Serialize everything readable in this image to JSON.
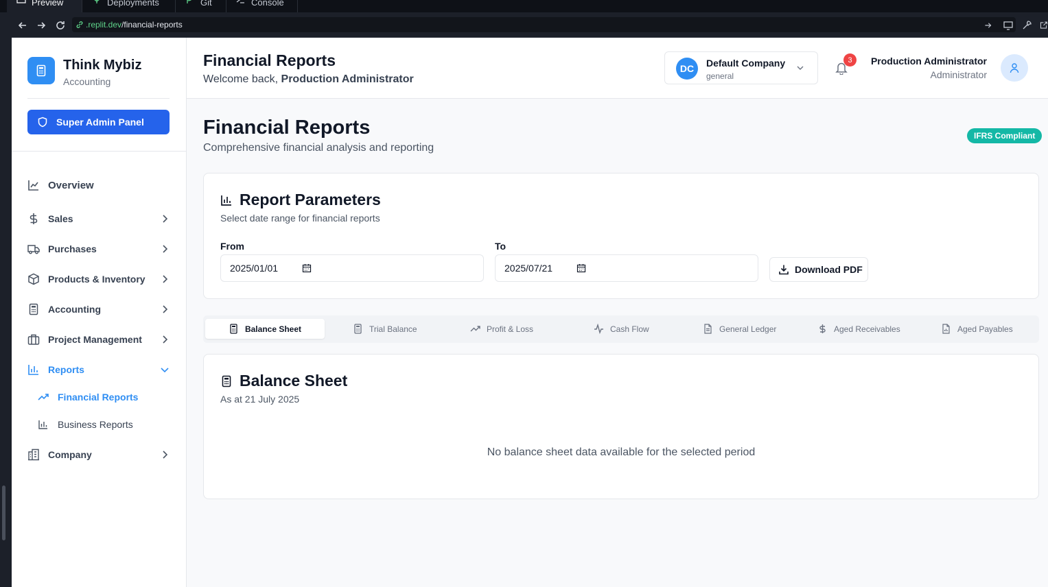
{
  "ide": {
    "tabs": [
      "Preview",
      "Deployments",
      "Git",
      "Console"
    ],
    "url_host": ".replit.dev",
    "url_path": "/financial-reports"
  },
  "sidebar": {
    "brand_title": "Think Mybiz",
    "brand_sub": "Accounting",
    "admin_button": "Super Admin Panel",
    "items": [
      {
        "label": "Overview",
        "icon": "line-chart-icon"
      },
      {
        "label": "Sales",
        "icon": "dollar-icon"
      },
      {
        "label": "Purchases",
        "icon": "truck-icon"
      },
      {
        "label": "Products & Inventory",
        "icon": "box-icon"
      },
      {
        "label": "Accounting",
        "icon": "calculator-icon"
      },
      {
        "label": "Project Management",
        "icon": "briefcase-icon"
      },
      {
        "label": "Reports",
        "icon": "bar-chart-icon"
      },
      {
        "label": "Company",
        "icon": "building-icon"
      }
    ],
    "sub_items": [
      {
        "label": "Financial Reports",
        "icon": "trending-up-icon"
      },
      {
        "label": "Business Reports",
        "icon": "bar-chart-icon"
      }
    ]
  },
  "topbar": {
    "title": "Financial Reports",
    "welcome_prefix": "Welcome back,",
    "welcome_name": "Production Administrator",
    "company_initials": "DC",
    "company_name": "Default Company",
    "company_type": "general",
    "notification_count": "3",
    "user_name": "Production Administrator",
    "user_role": "Administrator"
  },
  "page": {
    "title": "Financial Reports",
    "subtitle": "Comprehensive financial analysis and reporting",
    "badge": "IFRS Compliant"
  },
  "params": {
    "title": "Report Parameters",
    "subtitle": "Select date range for financial reports",
    "from_label": "From",
    "from_value": "2025/01/01",
    "to_label": "To",
    "to_value": "2025/07/21",
    "download_label": "Download PDF"
  },
  "tabs": [
    {
      "label": "Balance Sheet",
      "icon": "calculator-icon"
    },
    {
      "label": "Trial Balance",
      "icon": "calculator-icon"
    },
    {
      "label": "Profit & Loss",
      "icon": "trending-up-icon"
    },
    {
      "label": "Cash Flow",
      "icon": "activity-icon"
    },
    {
      "label": "General Ledger",
      "icon": "file-text-icon"
    },
    {
      "label": "Aged Receivables",
      "icon": "dollar-icon"
    },
    {
      "label": "Aged Payables",
      "icon": "file-icon"
    }
  ],
  "balance_sheet": {
    "title": "Balance Sheet",
    "subtitle": "As at 21 July 2025",
    "empty_message": "No balance sheet data available for the selected period"
  },
  "colors": {
    "accent": "#2f8ef3",
    "admin_button": "#2563eb",
    "badge_teal": "#14b8a6",
    "notification_red": "#ef4444"
  }
}
